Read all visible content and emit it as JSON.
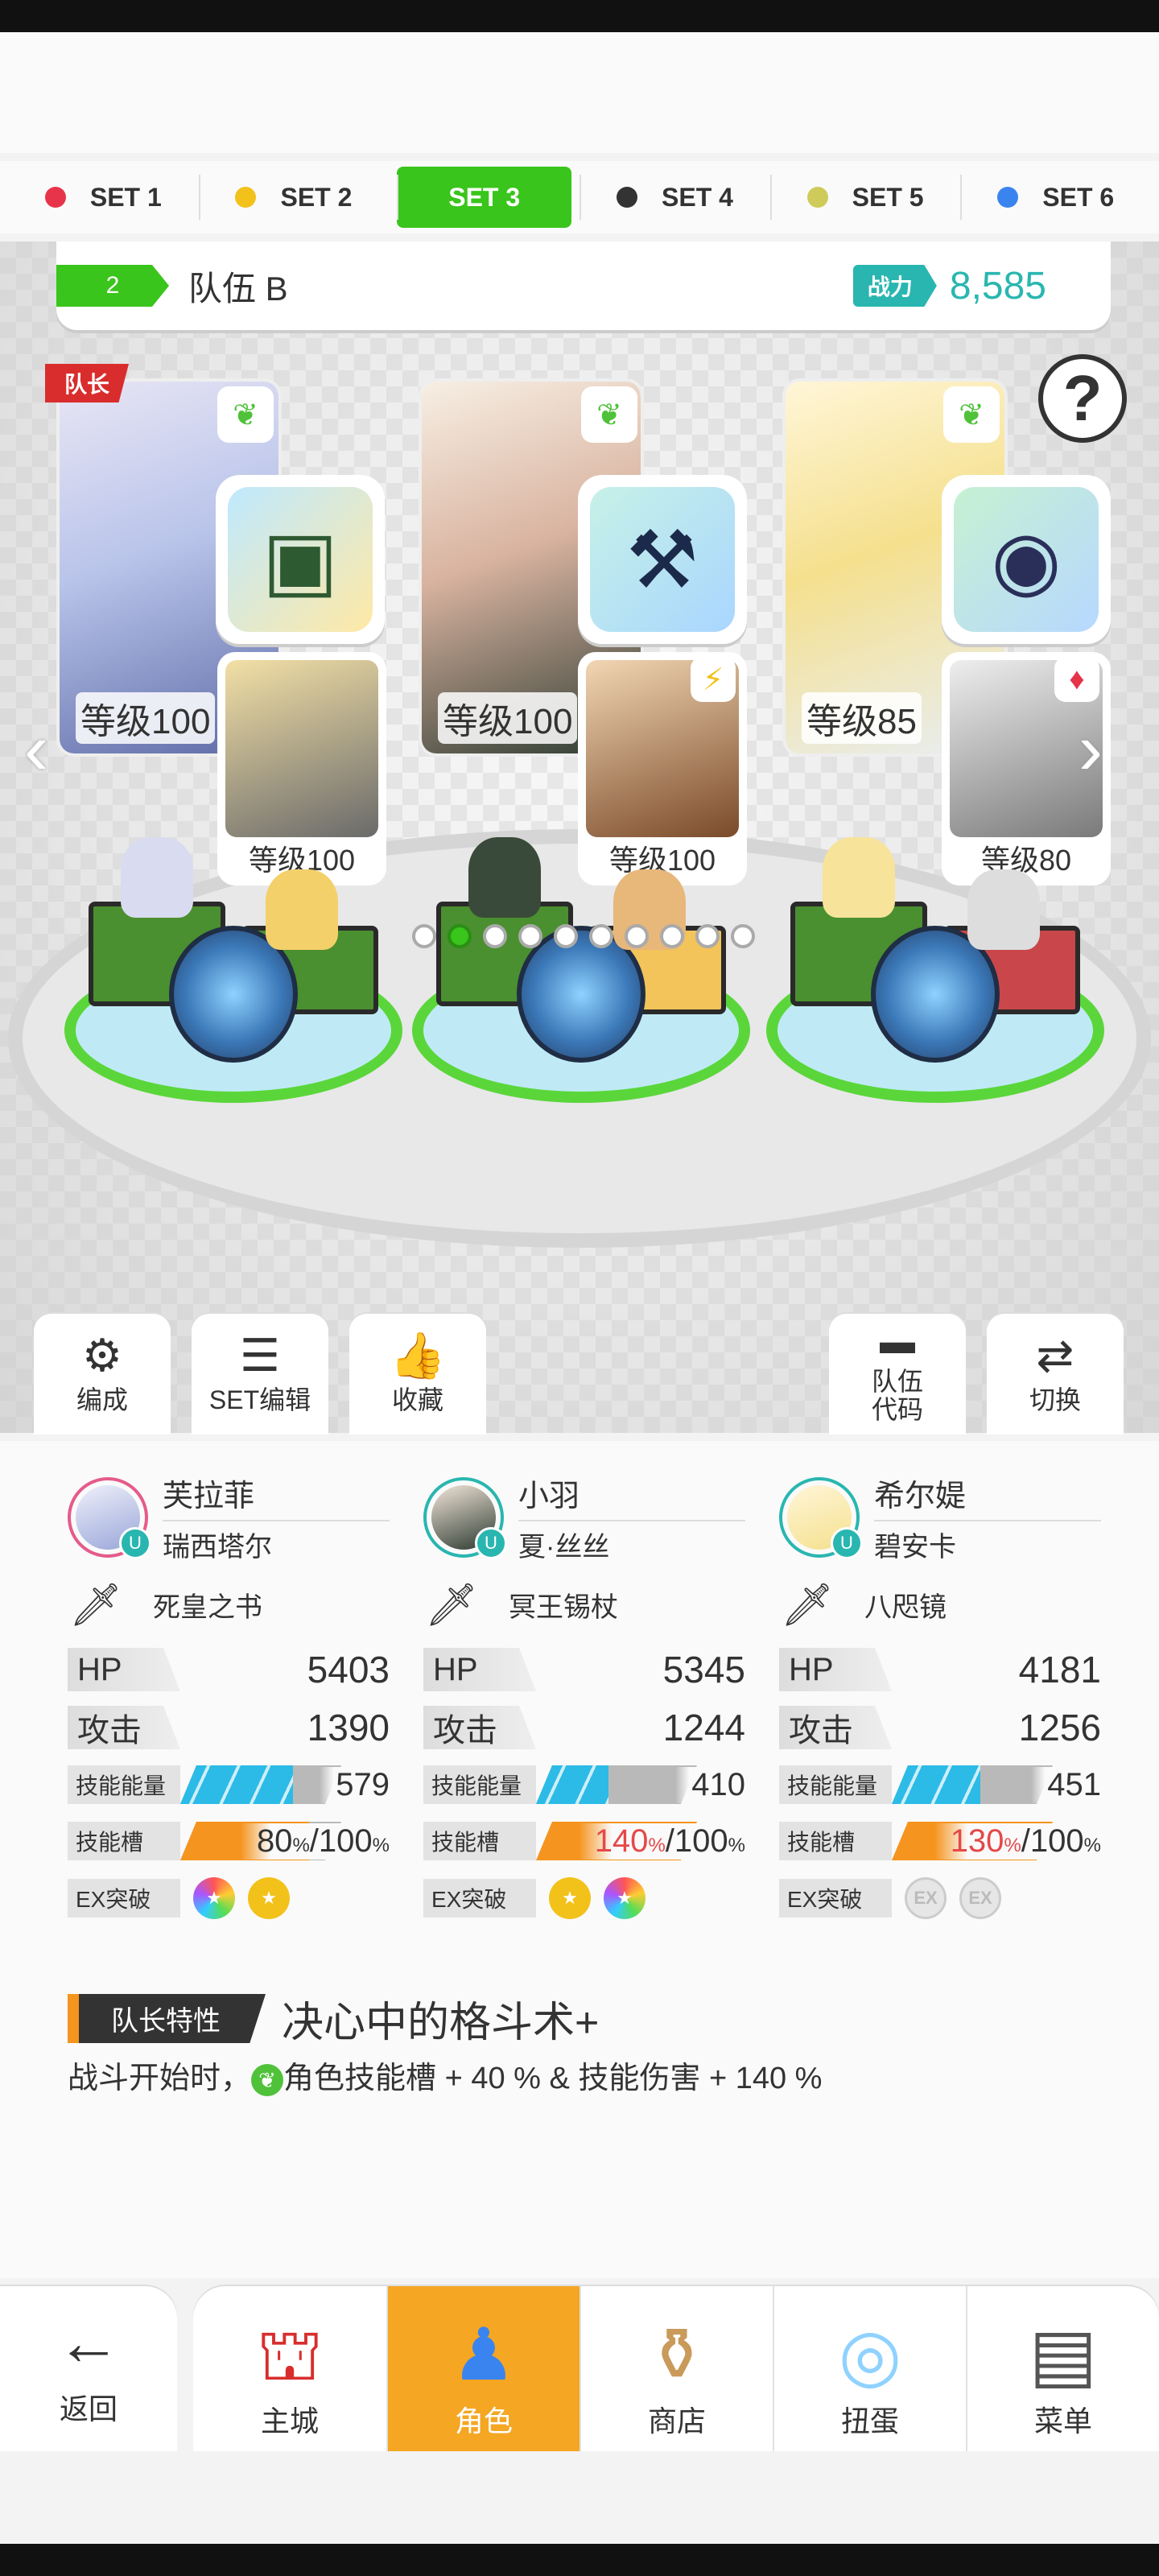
{
  "set_tabs": [
    {
      "label": "SET 1",
      "color": "#e8344a"
    },
    {
      "label": "SET 2",
      "color": "#f2c21b"
    },
    {
      "label": "SET 3",
      "color": "#39c51b"
    },
    {
      "label": "SET 4",
      "color": "#333333"
    },
    {
      "label": "SET 5",
      "color": "#cfcb5a"
    },
    {
      "label": "SET 6",
      "color": "#3a84f0"
    }
  ],
  "active_set": "SET 3",
  "team": {
    "number": "2",
    "name": "队伍 B",
    "power_label": "战力",
    "power_value": "8,585"
  },
  "help_label": "?",
  "leader_tag": "队长",
  "heroes": [
    {
      "level": "等级100",
      "sub_level": "等级100",
      "item_icon": "book-icon",
      "sub_badge": "leaf-icon"
    },
    {
      "level": "等级100",
      "sub_level": "等级100",
      "item_icon": "axe-icon",
      "sub_badge": "bolt-icon"
    },
    {
      "level": "等级85",
      "sub_level": "等级80",
      "item_icon": "mirror-icon",
      "sub_badge": "diamond-icon"
    }
  ],
  "tools": {
    "formation": "编成",
    "set_edit": "SET编辑",
    "favorite": "收藏",
    "team_code": "队伍\n代码",
    "switch": "切换"
  },
  "members": [
    {
      "name": "芙拉菲",
      "sub_name": "瑞西塔尔",
      "weapon": "死皇之书",
      "hp_label": "HP",
      "hp": "5403",
      "atk_label": "攻击",
      "atk": "1390",
      "skill_energy_label": "技能能量",
      "skill_energy": "579",
      "skill_slot_label": "技能槽",
      "skill_slot": "80",
      "skill_slot_max": "100",
      "ex_label": "EX突破"
    },
    {
      "name": "小羽",
      "sub_name": "夏·丝丝",
      "weapon": "冥王锡杖",
      "hp_label": "HP",
      "hp": "5345",
      "atk_label": "攻击",
      "atk": "1244",
      "skill_energy_label": "技能能量",
      "skill_energy": "410",
      "skill_slot_label": "技能槽",
      "skill_slot": "140",
      "skill_slot_max": "100",
      "ex_label": "EX突破"
    },
    {
      "name": "希尔媞",
      "sub_name": "碧安卡",
      "weapon": "八咫镜",
      "hp_label": "HP",
      "hp": "4181",
      "atk_label": "攻击",
      "atk": "1256",
      "skill_energy_label": "技能能量",
      "skill_energy": "451",
      "skill_slot_label": "技能槽",
      "skill_slot": "130",
      "skill_slot_max": "100",
      "ex_label": "EX突破"
    }
  ],
  "percent_sign": "%",
  "slash": "/",
  "ex_text": "EX",
  "leader_trait": {
    "label": "队长特性",
    "title": "决心中的格斗术+",
    "desc_pre": "战斗开始时，",
    "desc_post": "角色技能槽 + 40 % & 技能伤害 + 140 %"
  },
  "nav": {
    "back": "返回",
    "main_city": "主城",
    "character": "角色",
    "shop": "商店",
    "gacha": "扭蛋",
    "menu": "菜单"
  }
}
